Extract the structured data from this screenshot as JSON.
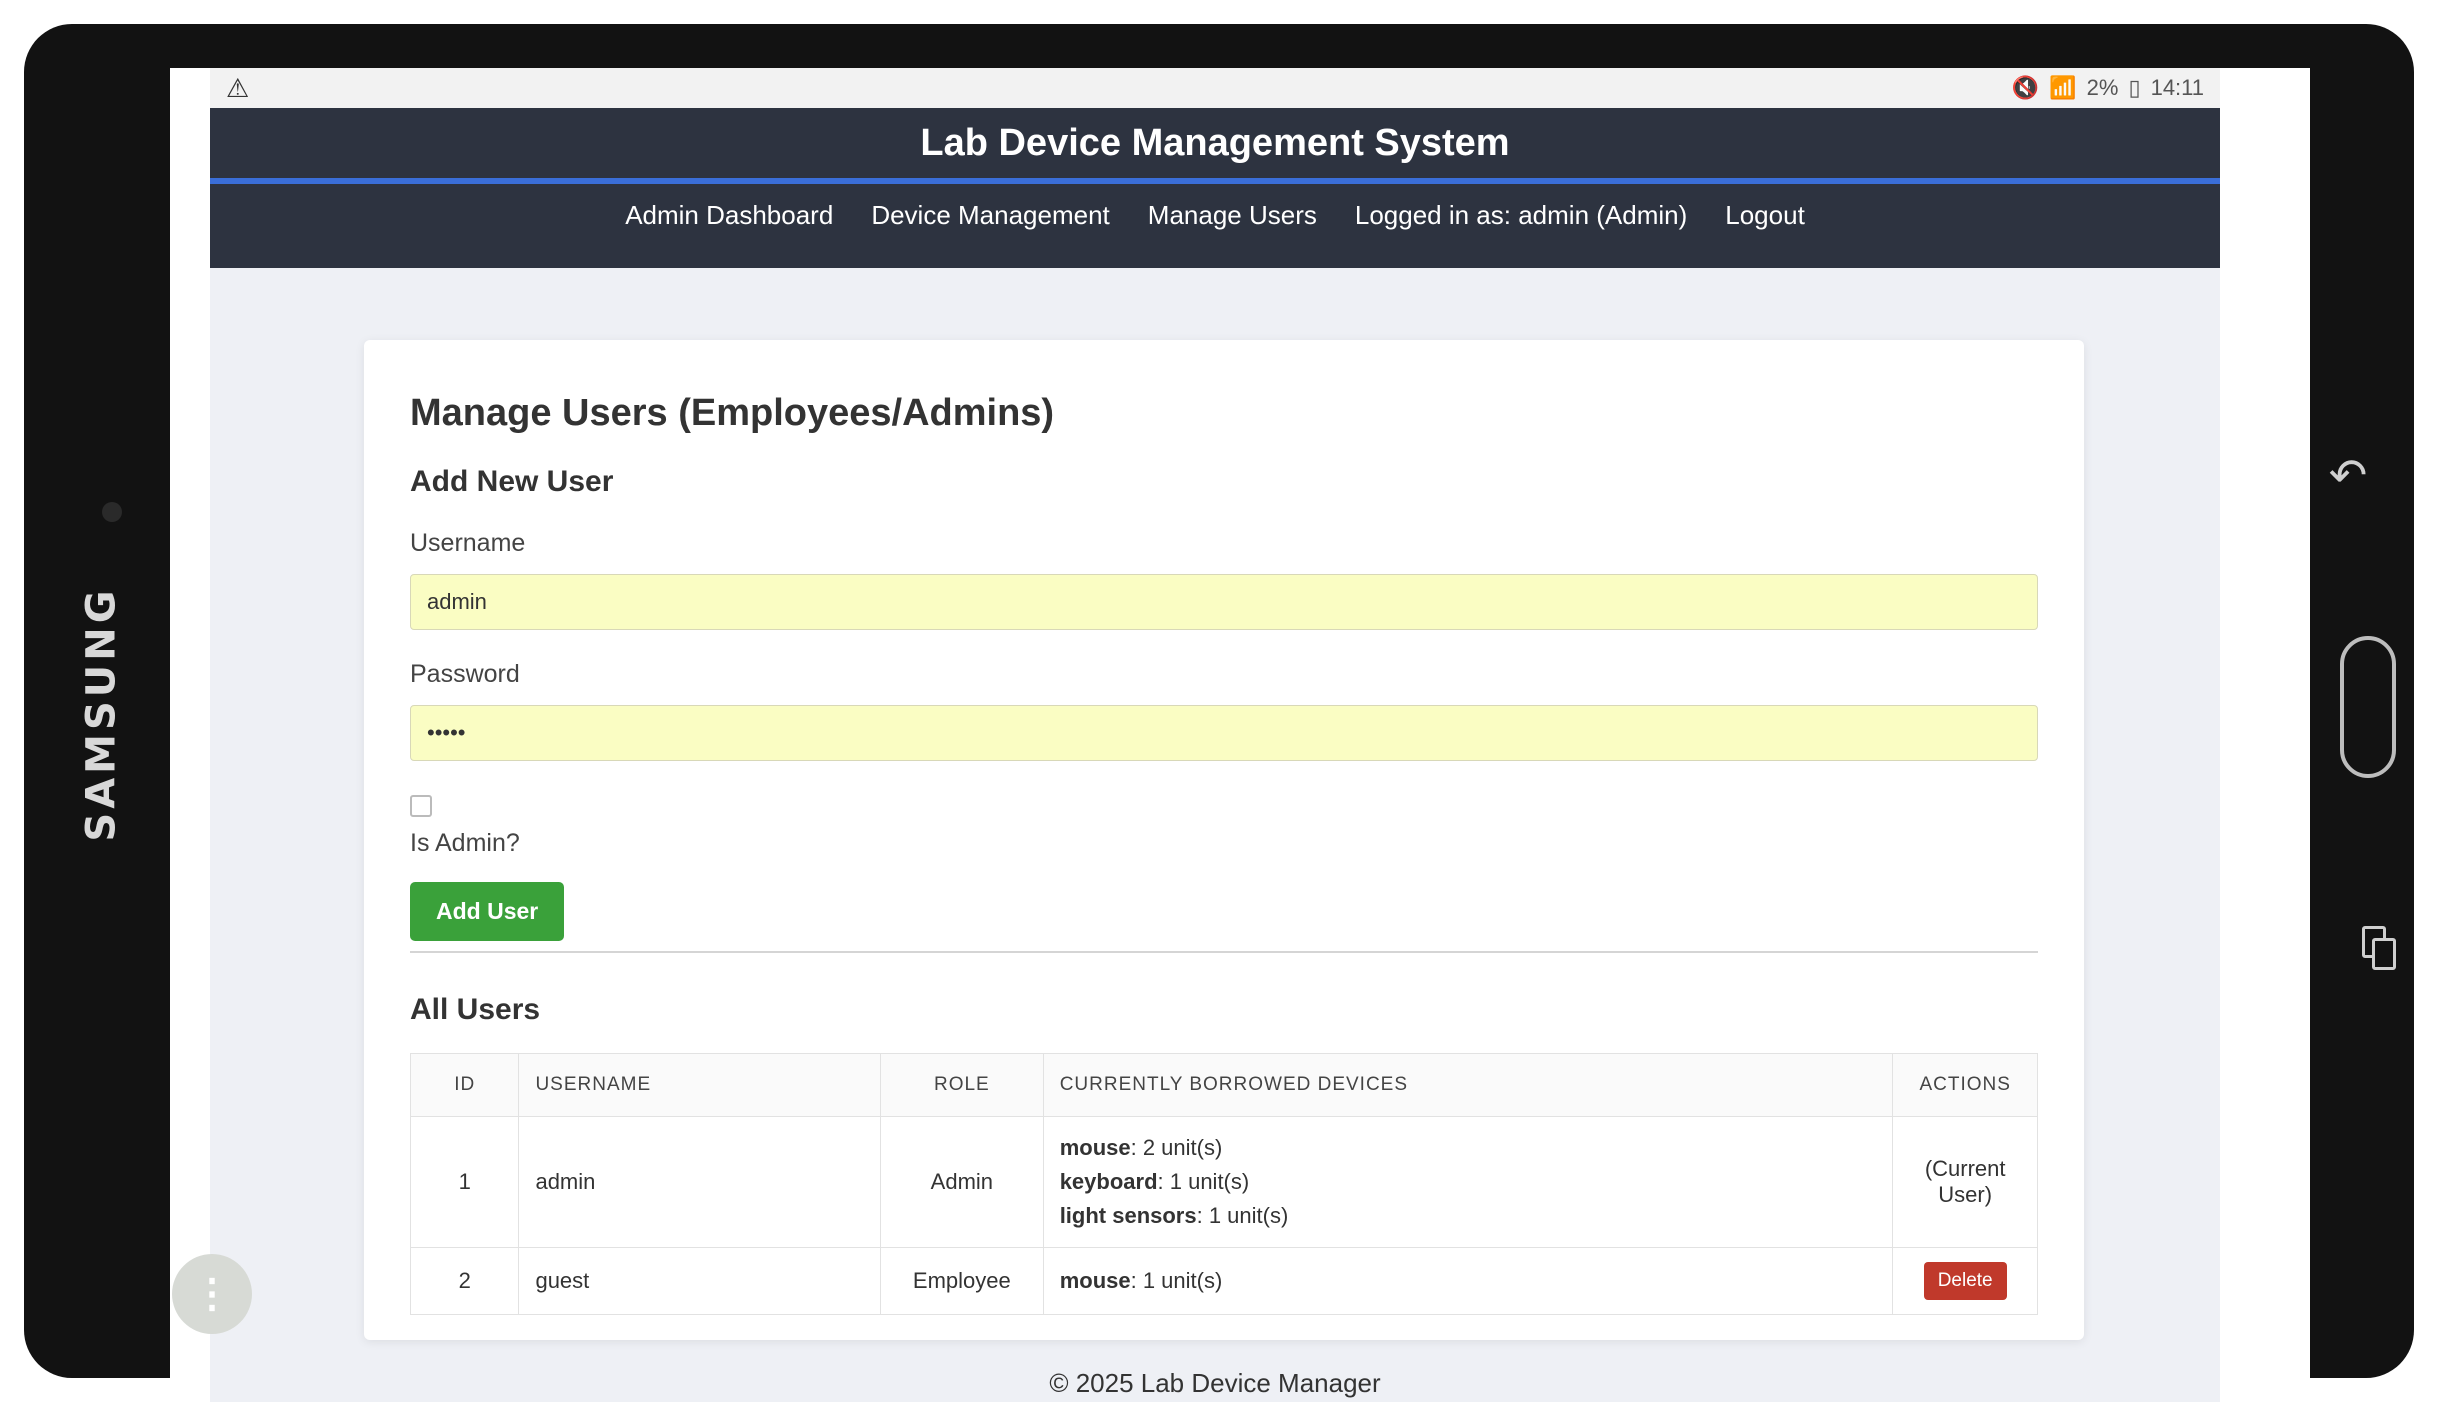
{
  "device": {
    "brand": "SAMSUNG"
  },
  "status_bar": {
    "icons": [
      "warning-icon",
      "mute-icon",
      "wifi-icon"
    ],
    "battery": "2%",
    "time": "14:11"
  },
  "header": {
    "title": "Lab Device Management System",
    "accent_color": "#3a6ed8",
    "nav": {
      "admin_dashboard": "Admin Dashboard",
      "device_management": "Device Management",
      "manage_users": "Manage Users",
      "logged_in": "Logged in as: admin (Admin)",
      "logout": "Logout"
    }
  },
  "page": {
    "title": "Manage Users (Employees/Admins)",
    "add_user": {
      "heading": "Add New User",
      "username_label": "Username",
      "username_value": "admin",
      "password_label": "Password",
      "password_value": "•••••",
      "is_admin_label": "Is Admin?",
      "is_admin_checked": false,
      "submit_label": "Add User",
      "submit_color": "#3aa13a"
    },
    "users": {
      "heading": "All Users",
      "columns": [
        "ID",
        "USERNAME",
        "ROLE",
        "CURRENTLY BORROWED DEVICES",
        "ACTIONS"
      ],
      "rows": [
        {
          "id": "1",
          "username": "admin",
          "role": "Admin",
          "devices": [
            {
              "name": "mouse",
              "qty": ": 2 unit(s)"
            },
            {
              "name": "keyboard",
              "qty": ": 1 unit(s)"
            },
            {
              "name": "light sensors",
              "qty": ": 1 unit(s)"
            }
          ],
          "action": "(Current User)"
        },
        {
          "id": "2",
          "username": "guest",
          "role": "Employee",
          "devices": [
            {
              "name": "mouse",
              "qty": ": 1 unit(s)"
            }
          ],
          "action": "Delete",
          "action_color": "#c0392b"
        }
      ]
    }
  },
  "footer": {
    "text": "© 2025 Lab Device Manager"
  },
  "hardware_buttons": [
    "back-icon",
    "home-button",
    "recent-apps-icon"
  ],
  "overlay": {
    "fab_icon": "more-vertical-icon"
  }
}
